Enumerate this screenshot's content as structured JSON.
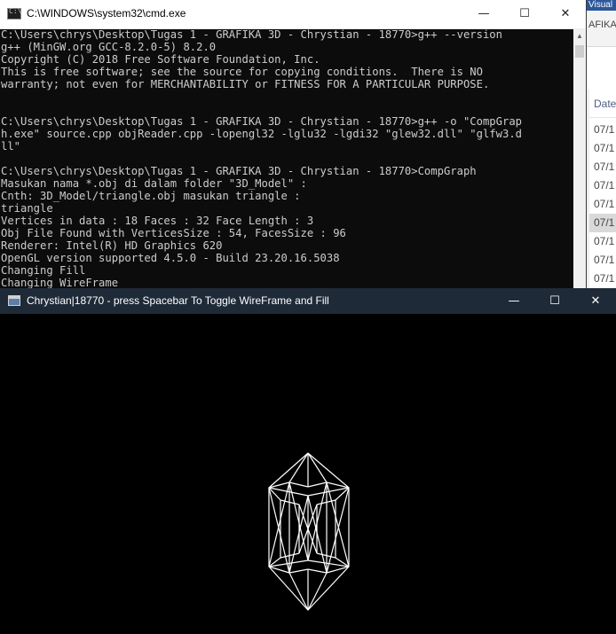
{
  "background_window": {
    "title_fragment": "Visual",
    "breadcrumb_fragment": "AFIKA",
    "column_header": "Date",
    "date_fragments": [
      "07/1",
      "07/1",
      "07/1",
      "07/1",
      "07/1",
      "07/1",
      "07/1",
      "07/1",
      "07/1"
    ],
    "selected_index": 5
  },
  "cmd_window": {
    "title": "C:\\WINDOWS\\system32\\cmd.exe",
    "icon_glyph": "C:\\",
    "controls": {
      "minimize": "—",
      "maximize": "☐",
      "close": "✕"
    },
    "lines": [
      "C:\\Users\\chrys\\Desktop\\Tugas 1 - GRAFIKA 3D - Chrystian - 18770>g++ --version",
      "g++ (MinGW.org GCC-8.2.0-5) 8.2.0",
      "Copyright (C) 2018 Free Software Foundation, Inc.",
      "This is free software; see the source for copying conditions.  There is NO",
      "warranty; not even for MERCHANTABILITY or FITNESS FOR A PARTICULAR PURPOSE.",
      "",
      "",
      "C:\\Users\\chrys\\Desktop\\Tugas 1 - GRAFIKA 3D - Chrystian - 18770>g++ -o \"CompGrap",
      "h.exe\" source.cpp objReader.cpp -lopengl32 -lglu32 -lgdi32 \"glew32.dll\" \"glfw3.d",
      "ll\"",
      "",
      "C:\\Users\\chrys\\Desktop\\Tugas 1 - GRAFIKA 3D - Chrystian - 18770>CompGraph",
      "Masukan nama *.obj di dalam folder \"3D_Model\" :",
      "Cnth: 3D_Model/triangle.obj masukan triangle :",
      "triangle",
      "Vertices in data : 18 Faces : 32 Face Length : 3",
      "Obj File Found with VerticesSize : 54, FacesSize : 96",
      "Renderer: Intel(R) HD Graphics 620",
      "OpenGL version supported 4.5.0 - Build 23.20.16.5038",
      "Changing Fill",
      "Changing WireFrame"
    ]
  },
  "gl_window": {
    "title": "Chrystian|18770 - press Spacebar To Toggle WireFrame and Fill",
    "controls": {
      "minimize": "—",
      "maximize": "☐",
      "close": "✕"
    },
    "render_mode": "WireFrame",
    "wire_color": "#ffffff",
    "background_color": "#000000"
  }
}
